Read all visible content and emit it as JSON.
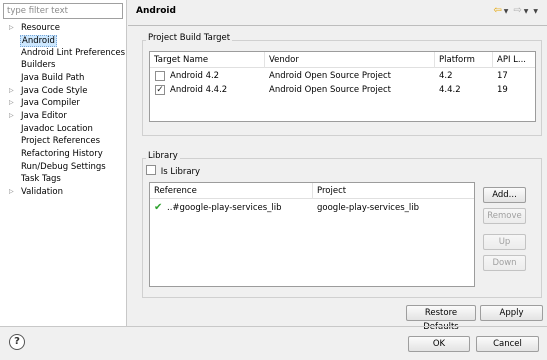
{
  "left_panel": {
    "filter_placeholder": "type filter text",
    "items": [
      {
        "label": "Resource",
        "expandable": true
      },
      {
        "label": "Android",
        "expandable": false,
        "selected": true
      },
      {
        "label": "Android Lint Preferences",
        "expandable": false
      },
      {
        "label": "Builders",
        "expandable": false
      },
      {
        "label": "Java Build Path",
        "expandable": false
      },
      {
        "label": "Java Code Style",
        "expandable": true
      },
      {
        "label": "Java Compiler",
        "expandable": true
      },
      {
        "label": "Java Editor",
        "expandable": true
      },
      {
        "label": "Javadoc Location",
        "expandable": false
      },
      {
        "label": "Project References",
        "expandable": false
      },
      {
        "label": "Refactoring History",
        "expandable": false
      },
      {
        "label": "Run/Debug Settings",
        "expandable": false
      },
      {
        "label": "Task Tags",
        "expandable": false
      },
      {
        "label": "Validation",
        "expandable": true
      }
    ]
  },
  "page": {
    "title": "Android",
    "nav_icons": [
      "back-arrow-icon",
      "dropdown-icon",
      "forward-arrow-icon",
      "dropdown-icon",
      "menu-dropdown-icon"
    ]
  },
  "build_target": {
    "group_title": "Project Build Target",
    "columns": [
      "Target Name",
      "Vendor",
      "Platform",
      "API L..."
    ],
    "rows": [
      {
        "checked": false,
        "name": "Android 4.2",
        "vendor": "Android Open Source Project",
        "platform": "4.2",
        "api": "17"
      },
      {
        "checked": true,
        "name": "Android 4.4.2",
        "vendor": "Android Open Source Project",
        "platform": "4.4.2",
        "api": "19"
      }
    ]
  },
  "library": {
    "group_title": "Library",
    "is_library_label": "Is Library",
    "is_library_checked": false,
    "columns": [
      "Reference",
      "Project"
    ],
    "rows": [
      {
        "reference": "..#google-play-services_lib",
        "project": "google-play-services_lib",
        "status": "ok"
      }
    ],
    "buttons": {
      "add": "Add...",
      "remove": "Remove",
      "up": "Up",
      "down": "Down"
    }
  },
  "actions": {
    "restore_defaults": "Restore Defaults",
    "apply": "Apply"
  },
  "footer": {
    "ok": "OK",
    "cancel": "Cancel"
  },
  "colors": {
    "selection": "#cde8ff",
    "check_green": "#2ea32e",
    "back_arrow": "#e5a400"
  }
}
